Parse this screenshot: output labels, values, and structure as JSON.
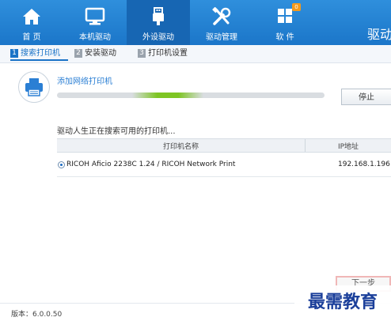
{
  "nav": {
    "items": [
      {
        "label": "首 页",
        "icon": "home-icon"
      },
      {
        "label": "本机驱动",
        "icon": "monitor-icon"
      },
      {
        "label": "外设驱动",
        "icon": "usb-icon"
      },
      {
        "label": "驱动管理",
        "icon": "tools-icon"
      },
      {
        "label": "软 件",
        "icon": "apps-grid-icon"
      }
    ],
    "active_index": 2,
    "software_badge": "0",
    "brand_text": "驱动"
  },
  "steps": [
    {
      "num": "1",
      "label": "搜索打印机"
    },
    {
      "num": "2",
      "label": "安装驱动"
    },
    {
      "num": "3",
      "label": "打印机设置"
    }
  ],
  "add_printer": {
    "title": "添加网络打印机",
    "stop_label": "停止"
  },
  "search": {
    "status": "驱动人生正在搜索可用的打印机...",
    "columns": [
      "打印机名称",
      "IP地址"
    ],
    "rows": [
      {
        "name": "RICOH Aficio 2238C 1.24 / RICOH Network Print",
        "ip": "192.168.1.196",
        "selected": true
      }
    ]
  },
  "next_label": "下一步",
  "footer": {
    "version": "版本：6.0.0.50"
  },
  "watermark": "最需教育",
  "colors": {
    "nav_bg": "#1b76c9",
    "nav_active": "#1766b3",
    "accent": "#1a73c7",
    "progress": "#7ec524",
    "badge": "#f59a1c"
  }
}
